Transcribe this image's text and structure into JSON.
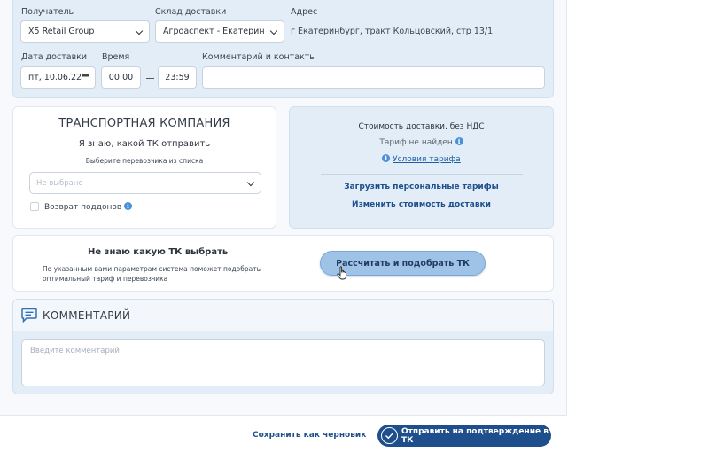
{
  "colors": {
    "panel_bg": "#e3edf7",
    "primary": "#1e4f8c",
    "link": "#1e5fa8",
    "info": "#4a90d9",
    "calc_button": "#9fc3e7"
  },
  "delivery": {
    "recipient_label": "Получатель",
    "recipient_value": "X5 Retail Group",
    "warehouse_label": "Склад доставки",
    "warehouse_value": "Агроаспект - Екатеринбу...",
    "address_label": "Адрес",
    "address_value": "г Екатеринбург, тракт Кольцовский, стр 13/1",
    "date_label": "Дата доставки",
    "date_value": "пт, 10.06.22",
    "time_label": "Время",
    "time_from": "00:00",
    "time_to": "23:59",
    "comment_contacts_label": "Комментарий и контакты",
    "comment_contacts_value": ""
  },
  "transport": {
    "title": "ТРАНСПОРТНАЯ КОМПАНИЯ",
    "subtitle": "Я знаю, какой ТК отправить",
    "hint": "Выберите перевозчика из списка",
    "select_placeholder": "Не выбрано",
    "return_pallets_label": "Возврат поддонов",
    "return_pallets_checked": false
  },
  "cost": {
    "title": "Стоимость доставки, без НДС",
    "not_found": "Тариф не найден",
    "tariff_terms": "Условия тарифа",
    "upload_tariffs": "Загрузить персональные тарифы",
    "change_cost": "Изменить стоимость доставки"
  },
  "dont_know": {
    "title": "Не знаю какую ТК выбрать",
    "description": "По указанным вами параметрам система поможет подобрать оптимальный тариф и перевозчика",
    "calc_button": "Рассчитать и подобрать ТК"
  },
  "comment": {
    "title": "КОММЕНТАРИЙ",
    "placeholder": "Введите комментарий"
  },
  "footer": {
    "save_draft": "Сохранить как черновик",
    "submit": "Отправить на подтверждение в ТК"
  },
  "icons": {
    "info": "i",
    "calendar": "calendar-icon",
    "comment": "chat-icon",
    "check": "check-circle-icon",
    "cursor": "hand-pointer-icon"
  }
}
